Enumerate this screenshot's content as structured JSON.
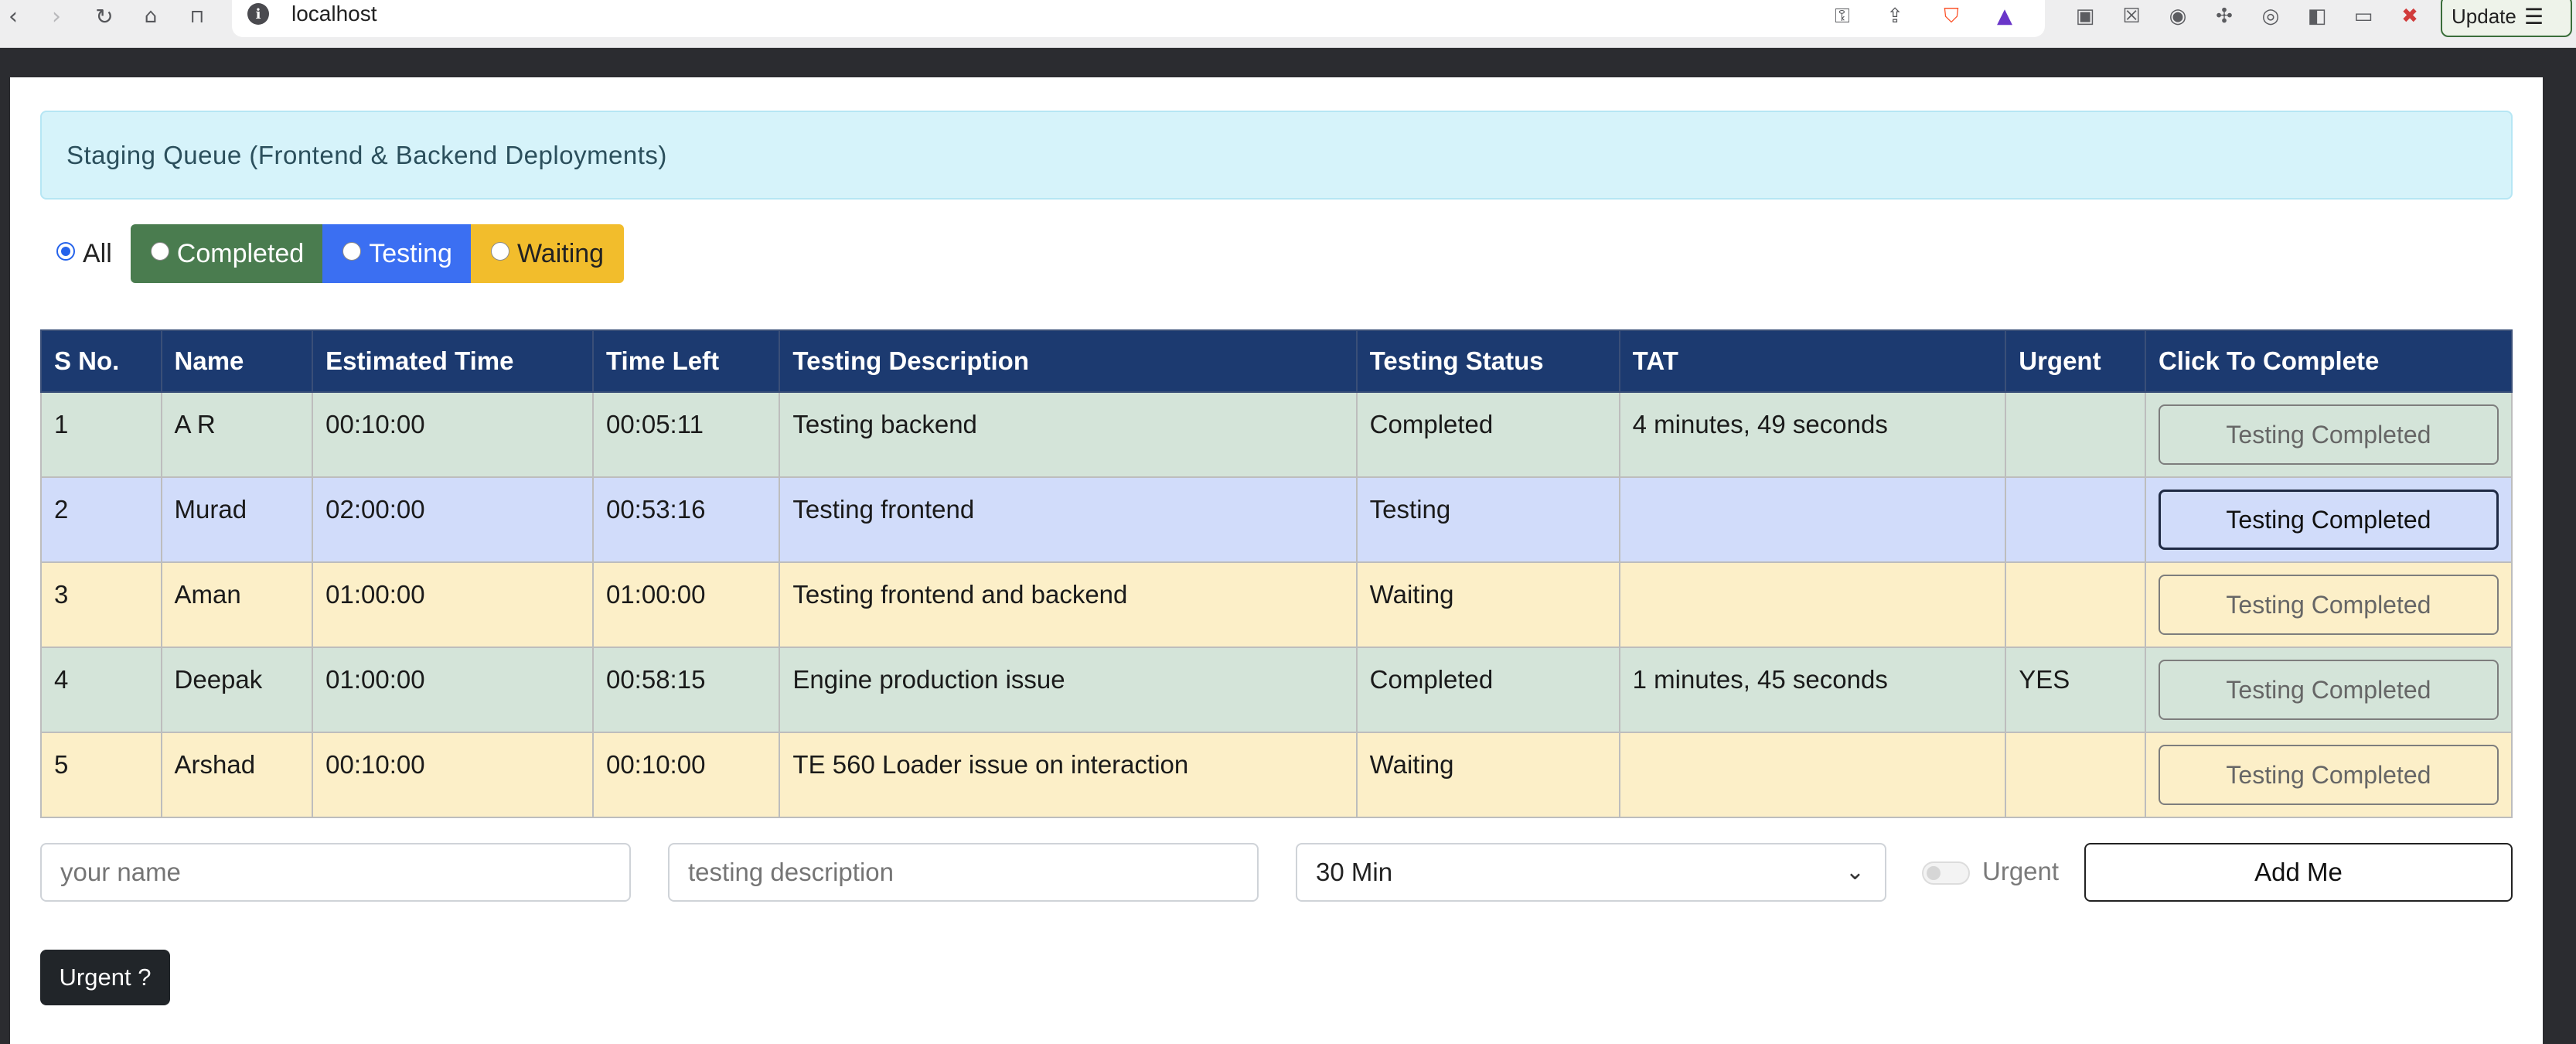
{
  "browser": {
    "url": "localhost",
    "update_label": "Update"
  },
  "page": {
    "alert_title": "Staging Queue (Frontend & Backend Deployments)",
    "filters": [
      {
        "label": "All",
        "selected": true
      },
      {
        "label": "Completed",
        "selected": false,
        "color": "#4a7c4f"
      },
      {
        "label": "Testing",
        "selected": false,
        "color": "#3b6ff2"
      },
      {
        "label": "Waiting",
        "selected": false,
        "color": "#f2bd2c"
      }
    ],
    "table": {
      "headers": [
        "S No.",
        "Name",
        "Estimated Time",
        "Time Left",
        "Testing Description",
        "Testing Status",
        "TAT",
        "Urgent",
        "Click To Complete"
      ],
      "rows": [
        {
          "sno": "1",
          "name": "A R",
          "estimated": "00:10:00",
          "left": "00:05:11",
          "description": "Testing backend",
          "status": "Completed",
          "tat": "4 minutes, 49 seconds",
          "urgent": "",
          "action": "Testing Completed"
        },
        {
          "sno": "2",
          "name": "Murad",
          "estimated": "02:00:00",
          "left": "00:53:16",
          "description": "Testing frontend",
          "status": "Testing",
          "tat": "",
          "urgent": "",
          "action": "Testing Completed"
        },
        {
          "sno": "3",
          "name": "Aman",
          "estimated": "01:00:00",
          "left": "01:00:00",
          "description": "Testing frontend and backend",
          "status": "Waiting",
          "tat": "",
          "urgent": "",
          "action": "Testing Completed"
        },
        {
          "sno": "4",
          "name": "Deepak",
          "estimated": "01:00:00",
          "left": "00:58:15",
          "description": "Engine production issue",
          "status": "Completed",
          "tat": "1 minutes, 45 seconds",
          "urgent": "YES",
          "action": "Testing Completed"
        },
        {
          "sno": "5",
          "name": "Arshad",
          "estimated": "00:10:00",
          "left": "00:10:00",
          "description": "TE 560 Loader issue on interaction",
          "status": "Waiting",
          "tat": "",
          "urgent": "",
          "action": "Testing Completed"
        }
      ]
    },
    "form": {
      "name_placeholder": "your name",
      "description_placeholder": "testing description",
      "duration_value": "30 Min",
      "urgent_toggle_label": "Urgent",
      "add_label": "Add Me"
    },
    "urgent_button_label": "Urgent ?"
  }
}
